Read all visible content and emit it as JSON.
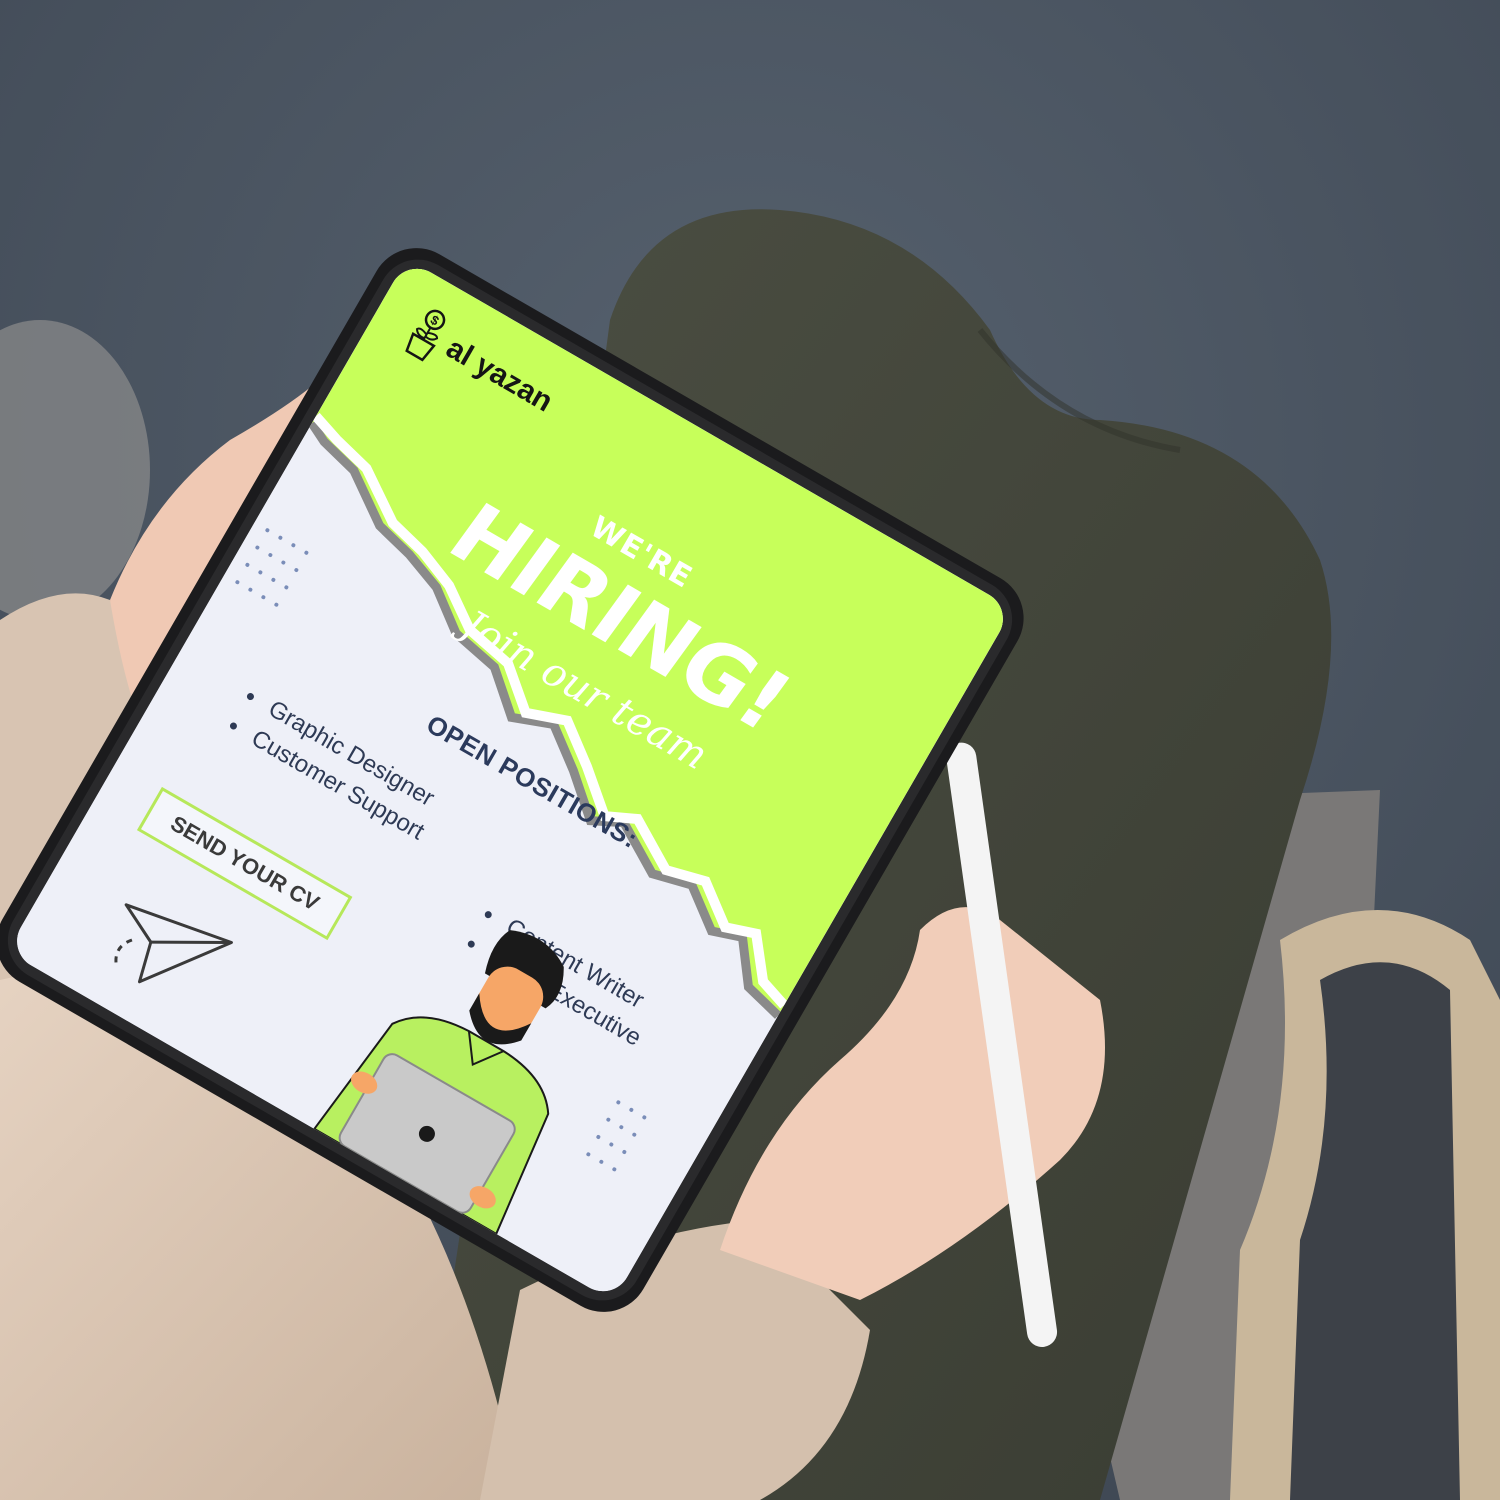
{
  "flyer": {
    "brand": "al yazan",
    "headline_top": "WE'RE",
    "headline_main": "HIRING!",
    "tagline": "Join our team",
    "positions_title": "OPEN POSITIONS:",
    "positions_left": [
      "Graphic Designer",
      "Customer Support"
    ],
    "positions_right": [
      "Content Writer",
      "Sales Executive"
    ],
    "cta": "SEND YOUR CV"
  },
  "colors": {
    "accent_green": "#c7ff5a",
    "screen_bg": "#eef0f8",
    "text_navy": "#2b3a5c",
    "background": "#4d5866"
  },
  "icons": {
    "brand": "money-plant-icon",
    "cta": "paper-plane-icon"
  }
}
